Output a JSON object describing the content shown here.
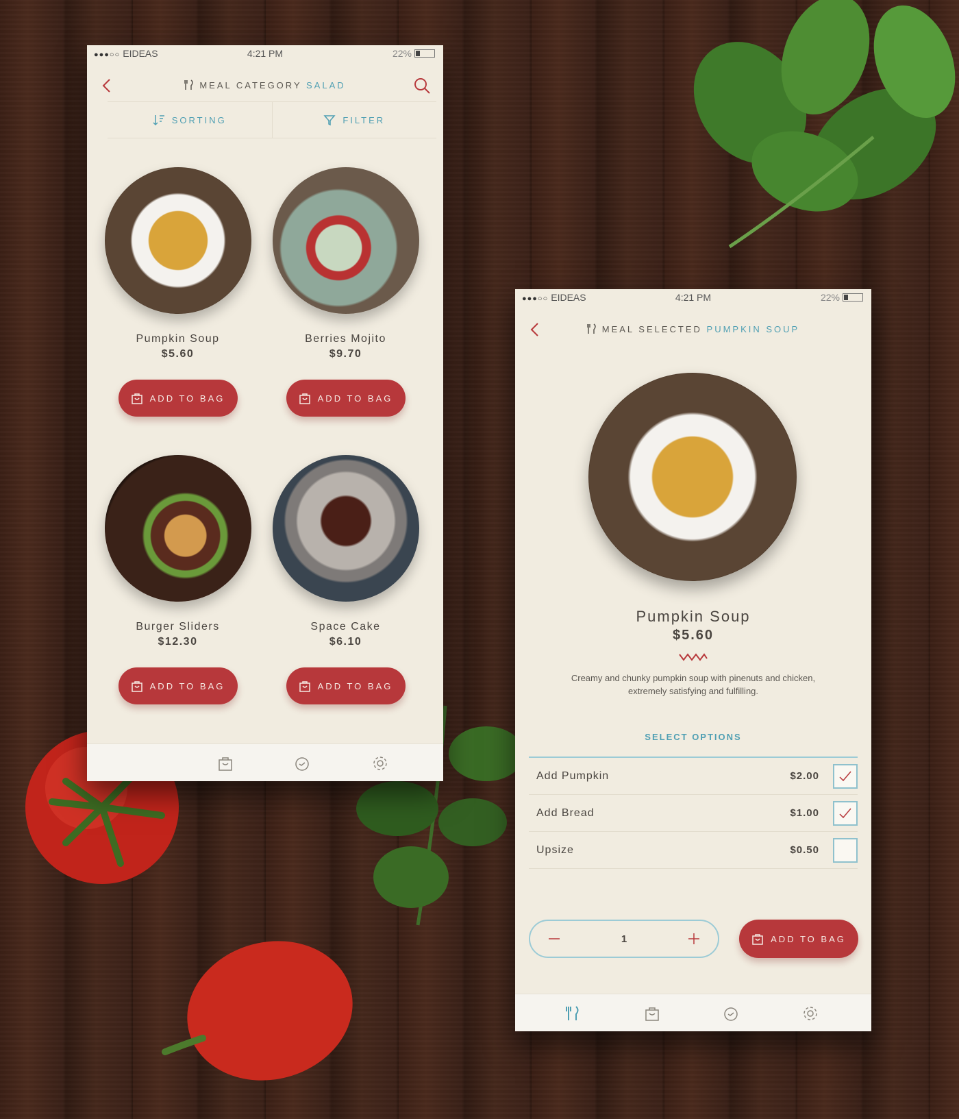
{
  "status_bar": {
    "carrier": "EIDEAS",
    "time": "4:21 PM",
    "battery": "22%"
  },
  "list_screen": {
    "nav": {
      "title_prefix": "MEAL CATEGORY",
      "title_accent": "SALAD"
    },
    "sort_label": "SORTING",
    "filter_label": "FILTER",
    "items": [
      {
        "name": "Pumpkin Soup",
        "price": "$5.60",
        "button": "ADD TO BAG",
        "photo": "pumpkin-soup"
      },
      {
        "name": "Berries Mojito",
        "price": "$9.70",
        "button": "ADD TO BAG",
        "photo": "berries-mojito"
      },
      {
        "name": "Burger Sliders",
        "price": "$12.30",
        "button": "ADD TO BAG",
        "photo": "burger"
      },
      {
        "name": "Space Cake",
        "price": "$6.10",
        "button": "ADD TO BAG",
        "photo": "space-cake"
      }
    ],
    "tabs": [
      "bag-icon",
      "clock-icon",
      "gear-icon"
    ]
  },
  "detail_screen": {
    "nav": {
      "title_prefix": "MEAL SELECTED",
      "title_accent": "PUMPKIN SOUP"
    },
    "name": "Pumpkin Soup",
    "price": "$5.60",
    "description_line1": "Creamy and chunky pumpkin soup with pinenuts and chicken,",
    "description_line2": "extremely satisfying and fulfilling.",
    "options_title": "SELECT OPTIONS",
    "options": [
      {
        "label": "Add Pumpkin",
        "price": "$2.00",
        "checked": true
      },
      {
        "label": "Add Bread",
        "price": "$1.00",
        "checked": true
      },
      {
        "label": "Upsize",
        "price": "$0.50",
        "checked": false
      }
    ],
    "quantity": "1",
    "add_button": "ADD TO BAG",
    "tabs": [
      "fork-knife-icon",
      "bag-icon",
      "clock-icon",
      "gear-icon"
    ]
  },
  "colors": {
    "accent_red": "#b7383b",
    "accent_teal": "#4f9fb3",
    "paper": "#f1ece0"
  }
}
